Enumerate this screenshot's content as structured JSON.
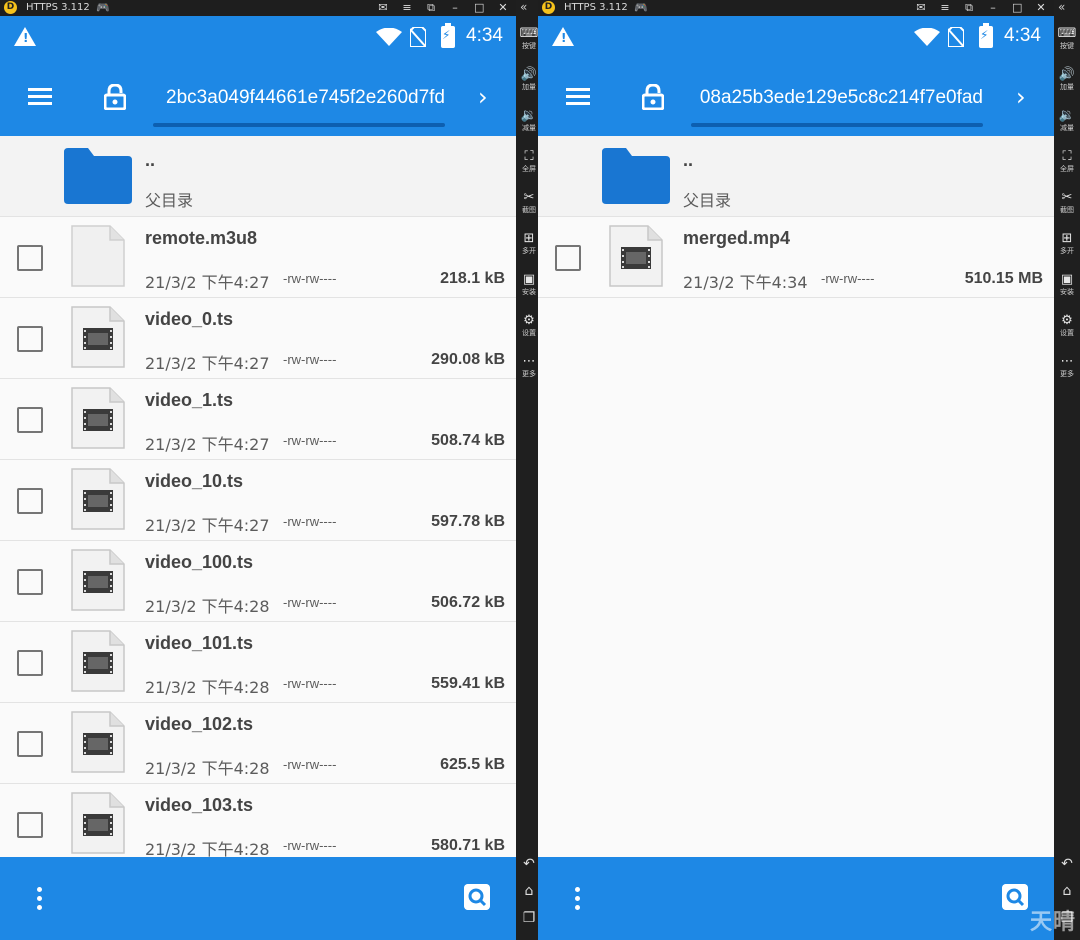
{
  "emulator_title": "HTTPS 3.112",
  "statusbar": {
    "time": "4:34"
  },
  "sidepanel": {
    "items": [
      {
        "label": "按键",
        "icon": "keyboard-icon",
        "glyph": "⌨"
      },
      {
        "label": "加量",
        "icon": "volume-up-icon",
        "glyph": "🔊"
      },
      {
        "label": "减量",
        "icon": "volume-down-icon",
        "glyph": "🔉"
      },
      {
        "label": "全屏",
        "icon": "fullscreen-icon",
        "glyph": "⛶"
      },
      {
        "label": "截图",
        "icon": "scissors-icon",
        "glyph": "✂"
      },
      {
        "label": "多开",
        "icon": "multi-open-icon",
        "glyph": "⊞"
      },
      {
        "label": "安装",
        "icon": "apk-install-icon",
        "glyph": "▣"
      },
      {
        "label": "设置",
        "icon": "settings-icon",
        "glyph": "⚙"
      },
      {
        "label": "更多",
        "icon": "more-icon",
        "glyph": "⋯"
      }
    ],
    "nav": [
      {
        "icon": "back-icon",
        "glyph": "↶"
      },
      {
        "icon": "home-icon",
        "glyph": "⌂"
      },
      {
        "icon": "recent-apps-icon",
        "glyph": "❐"
      }
    ]
  },
  "left": {
    "path": "2bc3a049f44661e745f2e260d7fd",
    "parent": {
      "name": "..",
      "label": "父目录"
    },
    "files": [
      {
        "name": "remote.m3u8",
        "date": "21/3/2 下午4:27",
        "perm": "-rw-rw----",
        "size": "218.1 kB",
        "type": "document"
      },
      {
        "name": "video_0.ts",
        "date": "21/3/2 下午4:27",
        "perm": "-rw-rw----",
        "size": "290.08 kB",
        "type": "video"
      },
      {
        "name": "video_1.ts",
        "date": "21/3/2 下午4:27",
        "perm": "-rw-rw----",
        "size": "508.74 kB",
        "type": "video"
      },
      {
        "name": "video_10.ts",
        "date": "21/3/2 下午4:27",
        "perm": "-rw-rw----",
        "size": "597.78 kB",
        "type": "video"
      },
      {
        "name": "video_100.ts",
        "date": "21/3/2 下午4:28",
        "perm": "-rw-rw----",
        "size": "506.72 kB",
        "type": "video"
      },
      {
        "name": "video_101.ts",
        "date": "21/3/2 下午4:28",
        "perm": "-rw-rw----",
        "size": "559.41 kB",
        "type": "video"
      },
      {
        "name": "video_102.ts",
        "date": "21/3/2 下午4:28",
        "perm": "-rw-rw----",
        "size": "625.5 kB",
        "type": "video"
      },
      {
        "name": "video_103.ts",
        "date": "21/3/2 下午4:28",
        "perm": "-rw-rw----",
        "size": "580.71 kB",
        "type": "video"
      }
    ]
  },
  "right": {
    "path": "08a25b3ede129e5c8c214f7e0fad",
    "parent": {
      "name": "..",
      "label": "父目录"
    },
    "files": [
      {
        "name": "merged.mp4",
        "date": "21/3/2 下午4:34",
        "perm": "-rw-rw----",
        "size": "510.15 MB",
        "type": "video"
      }
    ]
  },
  "watermark": "天晴",
  "colors": {
    "primary": "#1e88e5",
    "folder": "#1976d2",
    "background": "#fafafa"
  }
}
